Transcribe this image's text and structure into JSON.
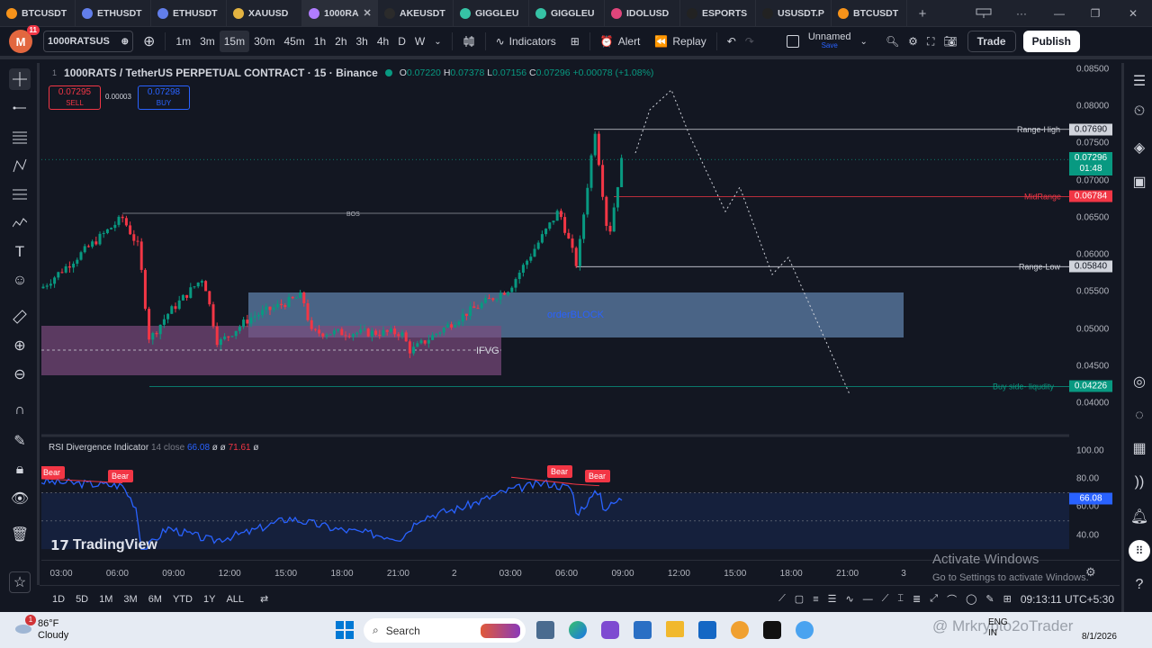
{
  "tabs": [
    {
      "label": "BTCUSDT",
      "color": "#f7931a",
      "active": false
    },
    {
      "label": "ETHUSDT",
      "color": "#627eea",
      "active": false
    },
    {
      "label": "ETHUSDT",
      "color": "#627eea",
      "active": false
    },
    {
      "label": "XAUUSD",
      "color": "#e3b341",
      "active": false
    },
    {
      "label": "1000RA",
      "color": "#b07cff",
      "active": true
    },
    {
      "label": "AKEUSDT",
      "color": "#2b2b2b",
      "active": false
    },
    {
      "label": "GIGGLEU",
      "color": "#36c2a5",
      "active": false
    },
    {
      "label": "GIGGLEU",
      "color": "#36c2a5",
      "active": false
    },
    {
      "label": "IDOLUSD",
      "color": "#e0457b",
      "active": false
    },
    {
      "label": "ESPORTS",
      "color": "#222",
      "active": false
    },
    {
      "label": "USUSDT.P",
      "color": "#222",
      "active": false
    },
    {
      "label": "BTCUSDT",
      "color": "#f7931a",
      "active": false
    }
  ],
  "toolbar": {
    "avatar_letter": "M",
    "notif_count": "11",
    "symbol": "1000RATSUS",
    "intervals": [
      "1m",
      "3m",
      "15m",
      "30m",
      "45m",
      "1h",
      "2h",
      "3h",
      "4h",
      "D",
      "W"
    ],
    "selected_interval": "15m",
    "indicators": "Indicators",
    "alert": "Alert",
    "replay": "Replay",
    "layout_name": "Unnamed",
    "layout_status": "Save",
    "trade": "Trade",
    "publish": "Publish"
  },
  "legend": {
    "title": "1000RATS / TetherUS PERPETUAL CONTRACT · 15 · Binance",
    "o_label": "O",
    "o": "0.07220",
    "h_label": "H",
    "h": "0.07378",
    "l_label": "L",
    "l": "0.07156",
    "c_label": "C",
    "c": "0.07296",
    "change": "+0.00078 (+1.08%)",
    "sell_price": "0.07295",
    "sell_label": "SELL",
    "spread": "0.00003",
    "buy_price": "0.07298",
    "buy_label": "BUY"
  },
  "annotations": {
    "bos": "BOS",
    "orderblock": "orderBLOCK",
    "ifvg": "IFVG",
    "range_high": "Range-High",
    "midrange": "MidRange",
    "range_low": "Range-Low",
    "liquidity": "Buy side- liqudity",
    "bear": "Bear"
  },
  "price_axis": {
    "labels": [
      "0.08500",
      "0.08000",
      "0.07500",
      "0.07000",
      "0.06500",
      "0.06000",
      "0.05500",
      "0.05000",
      "0.04500",
      "0.04000"
    ],
    "range_high": "0.07690",
    "current": "0.07296",
    "countdown": "01:48",
    "midrange": "0.06784",
    "range_low": "0.05840",
    "liquidity": "0.04226"
  },
  "rsi": {
    "name": "RSI Divergence Indicator",
    "params": "14 close",
    "v1": "66.08",
    "v2": "ø ø",
    "v3": "71.61",
    "v4": "ø",
    "axis": [
      "100.00",
      "80.00",
      "60.00",
      "40.00"
    ],
    "current": "66.08"
  },
  "time_axis": [
    "03:00",
    "06:00",
    "09:00",
    "12:00",
    "15:00",
    "18:00",
    "21:00",
    "2",
    "03:00",
    "06:00",
    "09:00",
    "12:00",
    "15:00",
    "18:00",
    "21:00",
    "3"
  ],
  "bottom": {
    "ranges": [
      "1D",
      "5D",
      "1M",
      "3M",
      "6M",
      "YTD",
      "1Y",
      "ALL"
    ],
    "clock": "09:13:11 UTC+5:30"
  },
  "brand": "TradingView",
  "watermark": {
    "line1": "Activate Windows",
    "line2": "Go to Settings to activate Windows."
  },
  "taskbar": {
    "temp": "86°F",
    "weather": "Cloudy",
    "search": "Search",
    "lang": "ENG",
    "region": "IN",
    "date": "8/1/2026",
    "user": "@ Mrkrypto2oTrader"
  },
  "colors": {
    "up": "#089981",
    "down": "#f23645",
    "bg": "#131722",
    "rsi": "#2962ff",
    "orderblock": "#5d7fa8",
    "ifvg": "#7a4a7c"
  }
}
